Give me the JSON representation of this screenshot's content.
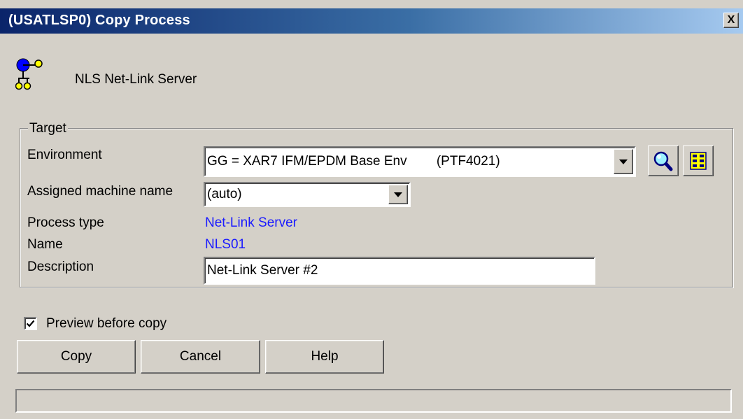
{
  "window": {
    "title": "(USATLSP0) Copy Process",
    "close_label": "X"
  },
  "header": {
    "process_label": "NLS  Net-Link Server",
    "icon": "network-tree-icon"
  },
  "target": {
    "group_label": "Target",
    "environment": {
      "label": "Environment",
      "value": "GG = XAR7 IFM/EPDM Base Env        (PTF4021)"
    },
    "machine": {
      "label": "Assigned machine name",
      "value": "(auto)"
    },
    "process_type": {
      "label": "Process type",
      "value": "Net-Link Server"
    },
    "name": {
      "label": "Name",
      "value": "NLS01"
    },
    "description": {
      "label": "Description",
      "value": "Net-Link Server #2"
    },
    "tools": [
      "search-icon",
      "list-columns-icon"
    ]
  },
  "preview": {
    "label": "Preview before copy",
    "checked": true
  },
  "buttons": {
    "copy": "Copy",
    "cancel": "Cancel",
    "help": "Help"
  },
  "colors": {
    "title_start": "#0a246a",
    "title_end": "#a6caf0",
    "link_text": "#1a1aff",
    "face": "#d4d0c8"
  }
}
